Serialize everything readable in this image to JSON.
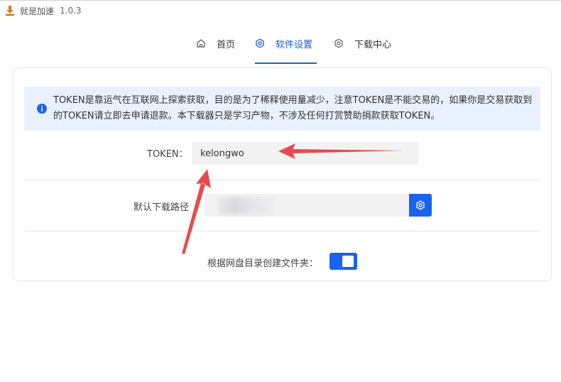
{
  "app": {
    "title": "就是加速",
    "version": "1.0.3"
  },
  "tabs": [
    {
      "label": "首页",
      "icon": "home-icon",
      "active": false
    },
    {
      "label": "软件设置",
      "icon": "gear-icon",
      "active": true
    },
    {
      "label": "下载中心",
      "icon": "gear-icon",
      "active": false
    }
  ],
  "notice": {
    "icon": "info-icon",
    "text": "TOKEN是靠运气在互联网上探索获取，目的是为了稀释使用量减少，注意TOKEN是不能交易的，如果你是交易获取到的TOKEN请立即去申请退款。本下载器只是学习产物，不涉及任何打赏赞助捐款获取TOKEN。"
  },
  "settings": {
    "token_label": "TOKEN：",
    "token_value": "kelongwo",
    "path_label": "默认下载路径",
    "path_value": "",
    "path_button_icon": "gear-icon",
    "folder_label": "根据网盘目录创建文件夹：",
    "folder_toggle_on": true
  },
  "colors": {
    "accent": "#1a63f0",
    "notice_bg": "#e8f1fd",
    "annotation_arrow": "#e84a4a"
  }
}
